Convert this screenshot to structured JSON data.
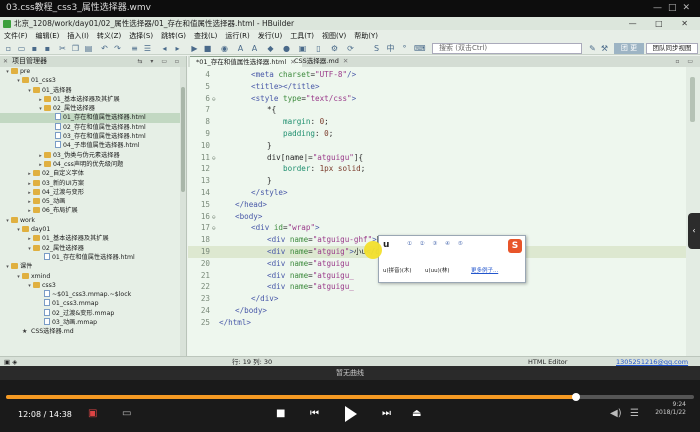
{
  "player": {
    "title": "03.css教程_css3_属性选择器.wmv",
    "no_curve": "暂无曲线",
    "time_elapsed": "12:08",
    "time_total": "14:38",
    "time_display": "12:08 / 14:38",
    "progress": 0.829,
    "clock": "9:24",
    "date": "2018/1/22"
  },
  "window": {
    "title": "北京_1208/work/day01/02_属性选择器/01_存在和值属性选择器.html - HBuilder",
    "controls": "—  □  ✕"
  },
  "menu": [
    "文件(F)",
    "编辑(E)",
    "插入(I)",
    "转义(Z)",
    "选择(S)",
    "跳转(G)",
    "查找(L)",
    "运行(R)",
    "发行(U)",
    "工具(T)",
    "视图(V)",
    "帮助(Y)"
  ],
  "toolbar": {
    "search_placeholder": "搜索 (双击Ctrl)",
    "theme_button": "团 更",
    "team_button": "团队同步视图"
  },
  "explorer": {
    "title": "项目管理器",
    "tree": [
      {
        "label": "pre",
        "level": 0,
        "arrow": "▾",
        "icon": "folder"
      },
      {
        "label": "01_css3",
        "level": 1,
        "arrow": "▾",
        "icon": "folder"
      },
      {
        "label": "01_选择器",
        "level": 2,
        "arrow": "▾",
        "icon": "folder"
      },
      {
        "label": "01_基本选择器及其扩展",
        "level": 3,
        "arrow": "▸",
        "icon": "folder"
      },
      {
        "label": "02_属性选择器",
        "level": 3,
        "arrow": "▾",
        "icon": "folder"
      },
      {
        "label": "01_存在和值属性选择器.html",
        "level": 4,
        "arrow": "",
        "icon": "file",
        "selected": true
      },
      {
        "label": "02_存在和值属性选择器.html",
        "level": 4,
        "arrow": "",
        "icon": "file"
      },
      {
        "label": "03_存在和值属性选择器.html",
        "level": 4,
        "arrow": "",
        "icon": "file"
      },
      {
        "label": "04_子串值属性选择器.html",
        "level": 4,
        "arrow": "",
        "icon": "file"
      },
      {
        "label": "03_伪类与伪元素选择器",
        "level": 3,
        "arrow": "▸",
        "icon": "folder"
      },
      {
        "label": "04_css声明的优先级问题",
        "level": 3,
        "arrow": "▸",
        "icon": "folder"
      },
      {
        "label": "02_自定义字体",
        "level": 2,
        "arrow": "▸",
        "icon": "folder"
      },
      {
        "label": "03_新的UI方案",
        "level": 2,
        "arrow": "▸",
        "icon": "folder"
      },
      {
        "label": "04_过渡与变形",
        "level": 2,
        "arrow": "▸",
        "icon": "folder"
      },
      {
        "label": "05_动画",
        "level": 2,
        "arrow": "▸",
        "icon": "folder"
      },
      {
        "label": "06_布局扩展",
        "level": 2,
        "arrow": "▸",
        "icon": "folder"
      },
      {
        "label": "work",
        "level": 0,
        "arrow": "▾",
        "icon": "folder"
      },
      {
        "label": "day01",
        "level": 1,
        "arrow": "▾",
        "icon": "folder"
      },
      {
        "label": "01_基本选择器及其扩展",
        "level": 2,
        "arrow": "▸",
        "icon": "folder"
      },
      {
        "label": "02_属性选择器",
        "level": 2,
        "arrow": "▾",
        "icon": "folder"
      },
      {
        "label": "01_存在和值属性选择器.html",
        "level": 3,
        "arrow": "",
        "icon": "file"
      },
      {
        "label": "课件",
        "level": 0,
        "arrow": "▾",
        "icon": "folder"
      },
      {
        "label": "xmind",
        "level": 1,
        "arrow": "▾",
        "icon": "folder"
      },
      {
        "label": "css3",
        "level": 2,
        "arrow": "▾",
        "icon": "folder"
      },
      {
        "label": "~$01_css3.mmap.~$lock",
        "level": 3,
        "arrow": "",
        "icon": "file"
      },
      {
        "label": "01_css3.mmap",
        "level": 3,
        "arrow": "",
        "icon": "file"
      },
      {
        "label": "02_过渡&变形.mmap",
        "level": 3,
        "arrow": "",
        "icon": "file"
      },
      {
        "label": "03_动画.mmap",
        "level": 3,
        "arrow": "",
        "icon": "file"
      },
      {
        "label": "CSS选择器.md",
        "level": 1,
        "arrow": "",
        "icon": "star"
      }
    ]
  },
  "tabs": [
    {
      "label": "*01_存在和值属性选择器.html",
      "active": true
    },
    {
      "label": "CSS选择器.md",
      "active": false
    }
  ],
  "code": [
    {
      "n": "4",
      "fold": "",
      "indent": 2,
      "parts": [
        [
          "tg",
          "<meta "
        ],
        [
          "at",
          "charset"
        ],
        [
          "pl",
          "="
        ],
        [
          "sv",
          "\"UTF-8\""
        ],
        [
          "tg",
          "/>"
        ]
      ]
    },
    {
      "n": "5",
      "fold": "",
      "indent": 2,
      "parts": [
        [
          "tg",
          "<title></title>"
        ]
      ]
    },
    {
      "n": "6",
      "fold": "⊖",
      "indent": 2,
      "parts": [
        [
          "tg",
          "<style "
        ],
        [
          "at",
          "type"
        ],
        [
          "pl",
          "="
        ],
        [
          "sv",
          "\"text/css\""
        ],
        [
          "tg",
          ">"
        ]
      ]
    },
    {
      "n": "7",
      "fold": "",
      "indent": 3,
      "parts": [
        [
          "pl",
          "*{"
        ]
      ]
    },
    {
      "n": "8",
      "fold": "",
      "indent": 4,
      "parts": [
        [
          "pr",
          "margin"
        ],
        [
          "pl",
          ": "
        ],
        [
          "pv",
          "0"
        ],
        [
          "pl",
          ";"
        ]
      ]
    },
    {
      "n": "9",
      "fold": "",
      "indent": 4,
      "parts": [
        [
          "pr",
          "padding"
        ],
        [
          "pl",
          ": "
        ],
        [
          "pv",
          "0"
        ],
        [
          "pl",
          ";"
        ]
      ]
    },
    {
      "n": "10",
      "fold": "",
      "indent": 3,
      "parts": [
        [
          "pl",
          "}"
        ]
      ]
    },
    {
      "n": "11",
      "fold": "⊖",
      "indent": 3,
      "parts": [
        [
          "pl",
          "div[name|="
        ],
        [
          "sv",
          "\"atguigu\""
        ],
        [
          "pl",
          "]{"
        ]
      ]
    },
    {
      "n": "12",
      "fold": "",
      "indent": 4,
      "parts": [
        [
          "pr",
          "border"
        ],
        [
          "pl",
          ": "
        ],
        [
          "pv",
          "1px solid"
        ],
        [
          "pl",
          ";"
        ]
      ]
    },
    {
      "n": "13",
      "fold": "",
      "indent": 3,
      "parts": [
        [
          "pl",
          "}"
        ]
      ]
    },
    {
      "n": "14",
      "fold": "",
      "indent": 2,
      "parts": [
        [
          "tg",
          "</style>"
        ]
      ]
    },
    {
      "n": "15",
      "fold": "",
      "indent": 1,
      "parts": [
        [
          "tg",
          "</head>"
        ]
      ]
    },
    {
      "n": "16",
      "fold": "⊖",
      "indent": 1,
      "parts": [
        [
          "tg",
          "<body>"
        ]
      ]
    },
    {
      "n": "17",
      "fold": "⊖",
      "indent": 2,
      "parts": [
        [
          "tg",
          "<div "
        ],
        [
          "at",
          "id"
        ],
        [
          "pl",
          "="
        ],
        [
          "sv",
          "\"wrap\""
        ],
        [
          "tg",
          ">"
        ]
      ]
    },
    {
      "n": "18",
      "fold": "",
      "indent": 3,
      "parts": [
        [
          "tg",
          "<div "
        ],
        [
          "at",
          "name"
        ],
        [
          "pl",
          "="
        ],
        [
          "sv",
          "\"atguigu-ghf\""
        ],
        [
          "tg",
          ">"
        ],
        [
          "pl",
          "圆滚滚"
        ],
        [
          "tg",
          "</div>"
        ]
      ]
    },
    {
      "n": "19",
      "fold": "",
      "indent": 3,
      "current": true,
      "parts": [
        [
          "tg",
          "<div "
        ],
        [
          "at",
          "name"
        ],
        [
          "pl",
          "="
        ],
        [
          "sv",
          "\"atguig\""
        ],
        [
          "tg",
          ">"
        ],
        [
          "pl",
          "小u"
        ],
        [
          "tg",
          "</div>"
        ]
      ]
    },
    {
      "n": "20",
      "fold": "",
      "indent": 3,
      "parts": [
        [
          "tg",
          "<div "
        ],
        [
          "at",
          "name"
        ],
        [
          "pl",
          "="
        ],
        [
          "sv",
          "\"atguigu "
        ]
      ]
    },
    {
      "n": "21",
      "fold": "",
      "indent": 3,
      "parts": [
        [
          "tg",
          "<div "
        ],
        [
          "at",
          "name"
        ],
        [
          "pl",
          "="
        ],
        [
          "sv",
          "\"atguigu_"
        ]
      ]
    },
    {
      "n": "22",
      "fold": "",
      "indent": 3,
      "parts": [
        [
          "tg",
          "<div "
        ],
        [
          "at",
          "name"
        ],
        [
          "pl",
          "="
        ],
        [
          "sv",
          "\"atguigu_"
        ]
      ]
    },
    {
      "n": "23",
      "fold": "",
      "indent": 2,
      "parts": [
        [
          "tg",
          "</div>"
        ]
      ]
    },
    {
      "n": "24",
      "fold": "",
      "indent": 1,
      "parts": [
        [
          "tg",
          "</body>"
        ]
      ]
    },
    {
      "n": "25",
      "fold": "",
      "indent": 0,
      "parts": [
        [
          "tg",
          "</html>"
        ]
      ]
    }
  ],
  "ime": {
    "input": "u",
    "candidates": "① ② ③ ④ ⑤",
    "option1": "u(拼音)(木)",
    "option2": "u(uu)(林)",
    "more": "更多例子..."
  },
  "status": {
    "position": "行: 19 列: 30",
    "mode": "HTML Editor",
    "user": "1305251216@qq.com"
  }
}
